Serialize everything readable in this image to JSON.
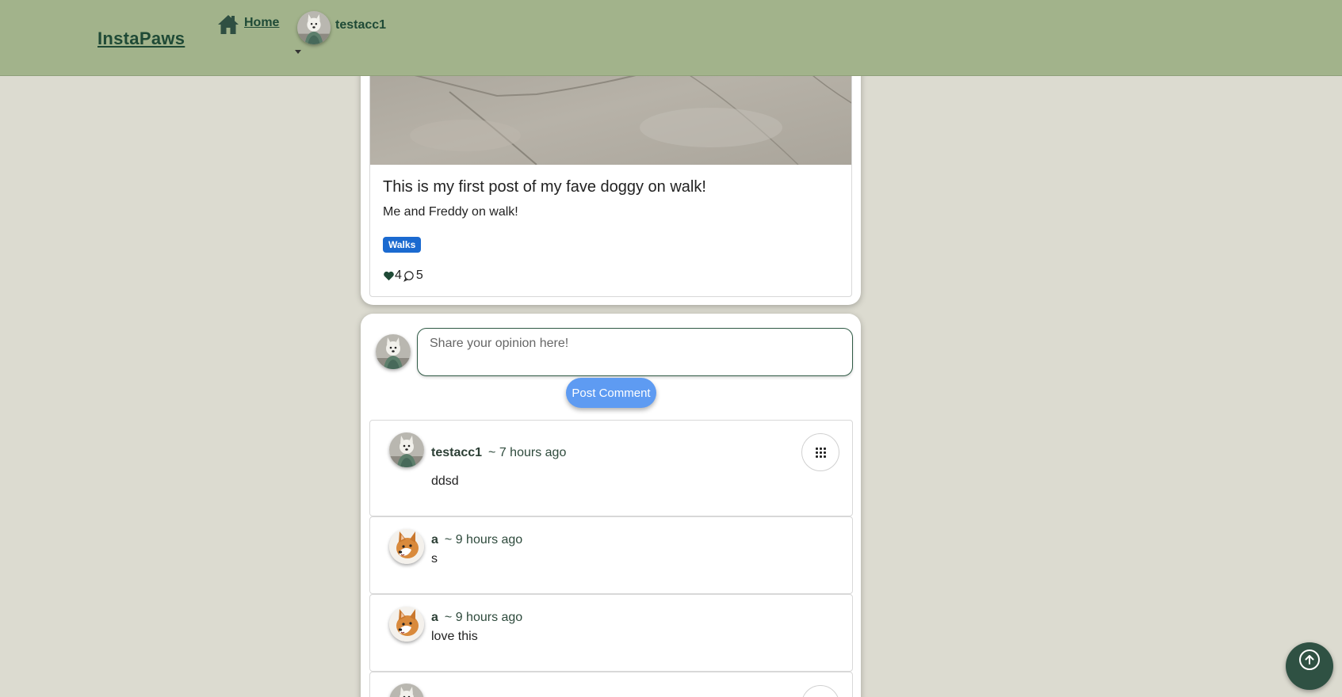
{
  "navbar": {
    "brand": "InstaPaws",
    "home_label": "Home",
    "home_icon": "house-icon",
    "username": "testacc1"
  },
  "post": {
    "title": "This is my first post of my fave doggy on walk!",
    "description": "Me and Freddy on walk!",
    "tag": "Walks",
    "like_count": "4",
    "comment_count": "5",
    "like_icon": "heart-icon",
    "comment_icon": "speech-bubble-icon",
    "colors": {
      "tag_bg": "#1b6ad0",
      "nav_bg": "#a2b38b",
      "page_bg": "#dcdbd0"
    }
  },
  "compose": {
    "placeholder": "Share your opinion here!",
    "button_label": "Post Comment"
  },
  "comments": [
    {
      "author": "testacc1",
      "time": "~ 7 hours ago",
      "text": "ddsd",
      "avatar": "westie-avatar",
      "has_options": true
    },
    {
      "author": "a",
      "time": "~ 9 hours ago",
      "text": "s",
      "avatar": "corgi-avatar",
      "has_options": false
    },
    {
      "author": "a",
      "time": "~ 9 hours ago",
      "text": "love this",
      "avatar": "corgi-avatar",
      "has_options": false
    }
  ],
  "scroll_top_icon": "arrow-up-icon"
}
